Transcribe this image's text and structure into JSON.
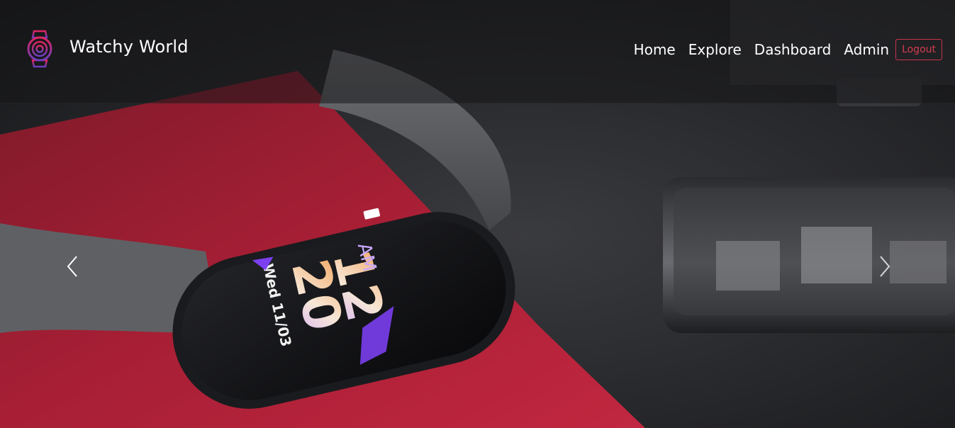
{
  "brand": {
    "name": "Watchy World",
    "icon": "smartwatch-logo-icon"
  },
  "nav": {
    "links": [
      "Home",
      "Explore",
      "Dashboard",
      "Admin"
    ],
    "logout_label": "Logout"
  },
  "carousel": {
    "prev_icon": "chevron-left-icon",
    "next_icon": "chevron-right-icon"
  },
  "hero_watch": {
    "time_hour": "12",
    "time_minute": "20",
    "ampm": "AM",
    "date": "Wed 11/03"
  },
  "colors": {
    "accent": "#c8344a",
    "logo_gradient": [
      "#e0245e",
      "#6a3fbf"
    ],
    "red_cloth": "#a51f33"
  }
}
